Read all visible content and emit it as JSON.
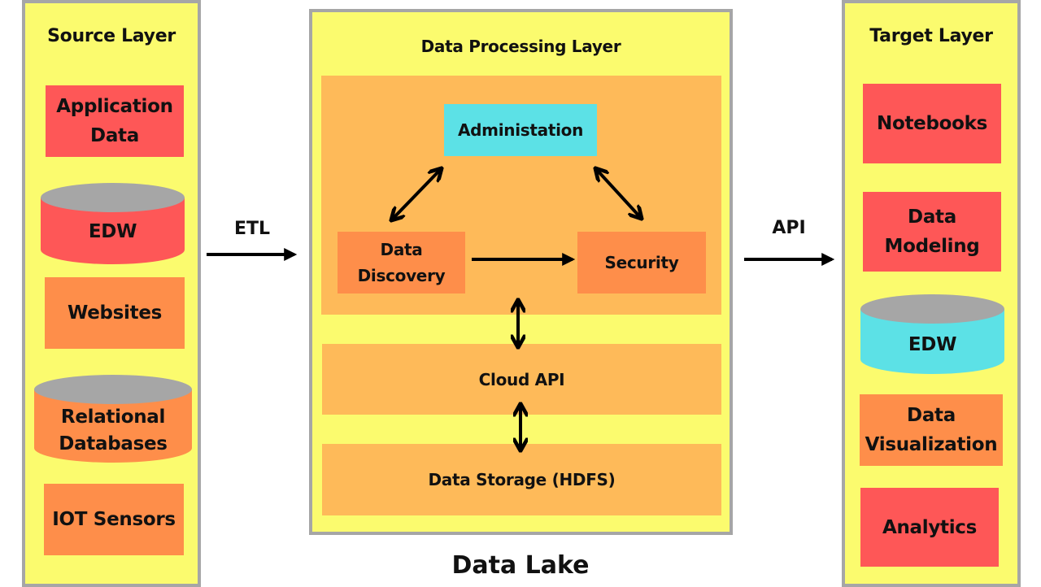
{
  "diagram_title": "Data Lake",
  "colors": {
    "panel_bg": "#fbfb6e",
    "panel_border": "#a6a6a6",
    "red": "#fe5757",
    "orange": "#fe8e4a",
    "cyan": "#5ce1e6",
    "light_orange": "#feba59",
    "cylinder_top": "#a6a6a6"
  },
  "source_layer": {
    "title": "Source Layer",
    "items": [
      {
        "label_line1": "Application",
        "label_line2": "Data",
        "shape": "rectangle",
        "color": "red"
      },
      {
        "label_line1": "EDW",
        "shape": "cylinder",
        "color": "red"
      },
      {
        "label_line1": "Websites",
        "shape": "rectangle",
        "color": "orange"
      },
      {
        "label_line1": "Relational",
        "label_line2": "Databases",
        "shape": "cylinder",
        "color": "orange"
      },
      {
        "label_line1": "IOT Sensors",
        "shape": "rectangle",
        "color": "orange"
      }
    ]
  },
  "connectors": {
    "etl_label": "ETL",
    "api_label": "API"
  },
  "processing_layer": {
    "title": "Data Processing Layer",
    "administration": "Administation",
    "data_discovery_line1": "Data",
    "data_discovery_line2": "Discovery",
    "security": "Security",
    "cloud_api": "Cloud API",
    "data_storage": "Data Storage (HDFS)"
  },
  "target_layer": {
    "title": "Target Layer",
    "items": [
      {
        "label_line1": "Notebooks",
        "shape": "rectangle",
        "color": "red"
      },
      {
        "label_line1": "Data",
        "label_line2": "Modeling",
        "shape": "rectangle",
        "color": "red"
      },
      {
        "label_line1": "EDW",
        "shape": "cylinder",
        "color": "cyan"
      },
      {
        "label_line1": "Data",
        "label_line2": "Visualization",
        "shape": "rectangle",
        "color": "orange"
      },
      {
        "label_line1": "Analytics",
        "shape": "rectangle",
        "color": "red"
      }
    ]
  }
}
